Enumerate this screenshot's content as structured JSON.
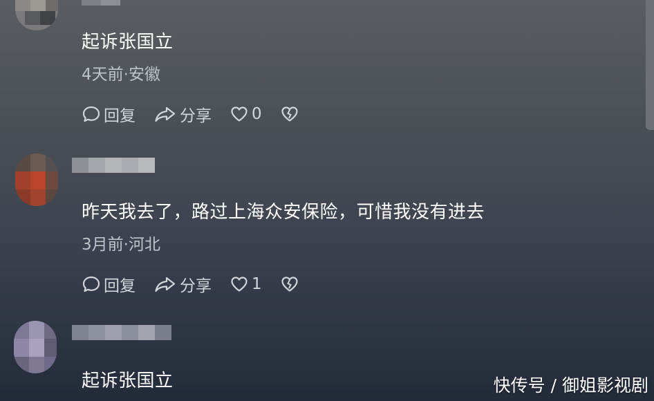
{
  "comments": [
    {
      "text": "起诉张国立",
      "meta": "4天前·安徽",
      "reply_label": "回复",
      "share_label": "分享",
      "like_count": "0"
    },
    {
      "text": "昨天我去了，路过上海众安保险，可惜我没有进去",
      "meta": "3月前·河北",
      "reply_label": "回复",
      "share_label": "分享",
      "like_count": "1"
    },
    {
      "text": "起诉张国立"
    }
  ],
  "watermark": "快传号 / 御姐影视剧",
  "icons": [
    "comment-bubble-icon",
    "share-arrow-icon",
    "heart-icon",
    "broken-heart-icon"
  ],
  "colors": {
    "text": "#ffffff",
    "meta": "#bfc3c9",
    "action": "#d2d5da"
  }
}
